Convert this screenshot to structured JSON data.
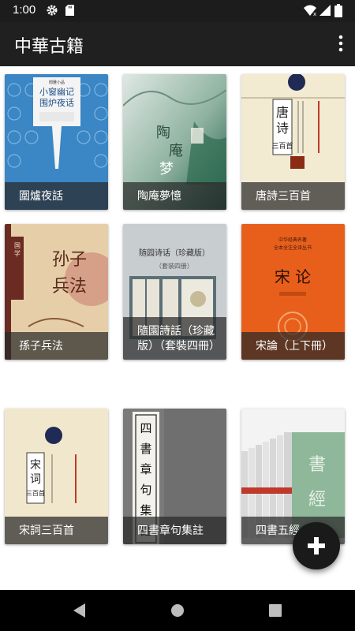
{
  "status_bar": {
    "time": "1:00",
    "icons": [
      "gear-icon",
      "sd-card-icon",
      "wifi-icon",
      "signal-icon",
      "battery-icon"
    ]
  },
  "app_bar": {
    "title": "中華古籍",
    "menu_icon": "more-vert-icon"
  },
  "books": [
    {
      "title": "圍爐夜話",
      "cover_text": "小窗幽记 围炉夜话"
    },
    {
      "title": "陶庵夢憶",
      "cover_text": "陶庵梦忆"
    },
    {
      "title": "唐詩三百首",
      "cover_text": "唐诗三百首"
    },
    {
      "title": "孫子兵法",
      "cover_text": "孙子兵法"
    },
    {
      "title": "隨園詩話（珍藏版）（套裝四冊）",
      "cover_text": "随园诗话（珍藏版）（套装四册）"
    },
    {
      "title": "宋論（上下冊）",
      "cover_text": "宋论"
    },
    {
      "title": "宋詞三百首",
      "cover_text": "宋词三百首"
    },
    {
      "title": "四書章句集註",
      "cover_text": "四書章句集註"
    },
    {
      "title": "四書五經",
      "cover_text": "四書五經"
    }
  ],
  "fab": {
    "icon": "add-icon"
  },
  "nav_bar": {
    "icons": [
      "back-icon",
      "home-icon",
      "recents-icon"
    ]
  },
  "colors": {
    "app_bar": "#202020",
    "status_bar": "#1c1c1c",
    "caption_bg": "#282828",
    "fab": "#1a1a1a"
  }
}
